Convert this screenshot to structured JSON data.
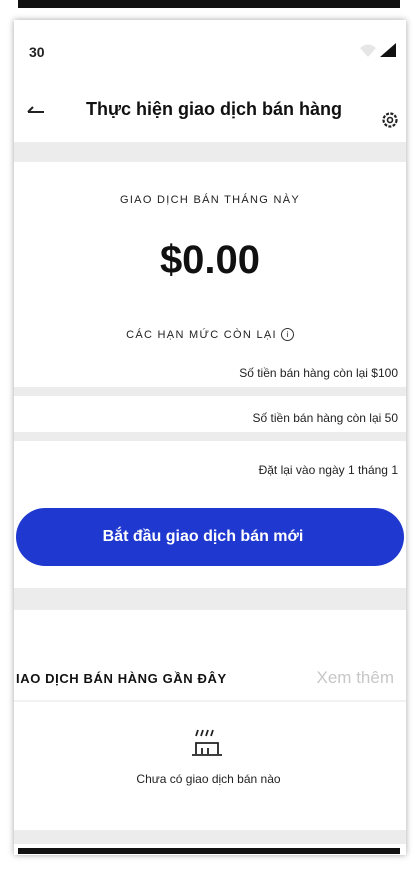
{
  "status_bar": {
    "time": "30"
  },
  "header": {
    "title": "Thực hiện giao dịch bán hàng"
  },
  "summary": {
    "label": "GIAO DỊCH BÁN THÁNG NÀY",
    "amount": "$0.00"
  },
  "limits": {
    "label": "CÁC HẠN MỨC CÒN LẠI",
    "info_icon": "ⓘ",
    "rows": [
      "Số tiền bán hàng còn lại $100",
      "Số tiền bán hàng còn lại  50",
      "Đặt lại vào ngày 1 tháng 1"
    ]
  },
  "cta": {
    "label": "Bắt đầu giao dịch bán mới"
  },
  "recent": {
    "title": "IAO DỊCH BÁN HÀNG GẦN ĐÂY",
    "see_more": "Xem thêm",
    "empty_text": "Chưa có giao dịch bán nào"
  },
  "colors": {
    "primary": "#1f39d0",
    "muted": "#c7c7c7",
    "divider": "#ececec"
  },
  "icons": [
    "back-arrow-icon",
    "gear-icon",
    "wifi-icon",
    "signal-icon",
    "info-icon",
    "empty-store-icon"
  ]
}
